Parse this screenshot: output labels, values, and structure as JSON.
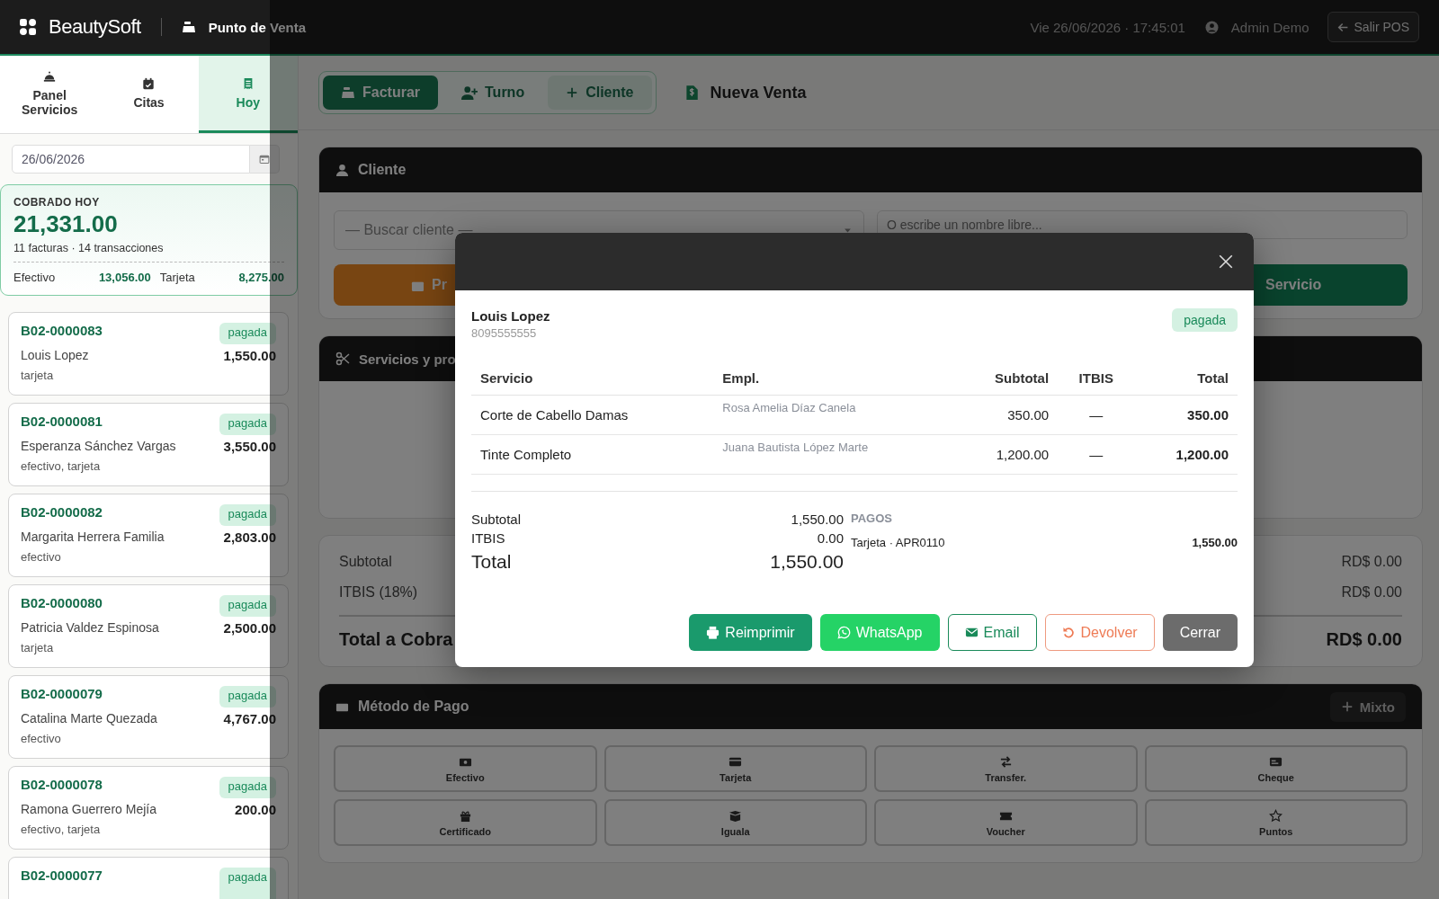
{
  "topbar": {
    "brand": "BeautySoft",
    "module": "Punto de Venta",
    "datetime": "Vie 26/06/2026 · 17:45:01",
    "user": "Admin Demo",
    "exit_button": "Salir POS"
  },
  "sidebar": {
    "tabs": [
      {
        "label": "Panel Servicios",
        "selected": false
      },
      {
        "label": "Citas",
        "selected": false
      },
      {
        "label": "Hoy",
        "selected": true
      }
    ],
    "date_field": {
      "value": "26/06/2026"
    },
    "summary": {
      "title": "COBRADO HOY",
      "amount": "21,331.00",
      "detail": "11 facturas · 14 transacciones",
      "breakdown": [
        {
          "label": "Efectivo",
          "amount": "13,056.00"
        },
        {
          "label": "Tarjeta",
          "amount": "8,275.00"
        }
      ]
    },
    "invoices": [
      {
        "number": "B02-0000083",
        "status": "pagada",
        "client": "Louis Lopez",
        "amount": "1,550.00",
        "methods": "tarjeta"
      },
      {
        "number": "B02-0000081",
        "status": "pagada",
        "client": "Esperanza Sánchez Vargas",
        "amount": "3,550.00",
        "methods": "efectivo, tarjeta"
      },
      {
        "number": "B02-0000082",
        "status": "pagada",
        "client": "Margarita Herrera Familia",
        "amount": "2,803.00",
        "methods": "efectivo"
      },
      {
        "number": "B02-0000080",
        "status": "pagada",
        "client": "Patricia Valdez Espinosa",
        "amount": "2,500.00",
        "methods": "tarjeta"
      },
      {
        "number": "B02-0000079",
        "status": "pagada",
        "client": "Catalina Marte Quezada",
        "amount": "4,767.00",
        "methods": "efectivo"
      },
      {
        "number": "B02-0000078",
        "status": "pagada",
        "client": "Ramona Guerrero Mejía",
        "amount": "200.00",
        "methods": "efectivo, tarjeta"
      },
      {
        "number": "B02-0000077",
        "status": "pagada"
      }
    ]
  },
  "main": {
    "mode_tabs": [
      {
        "label": "Facturar",
        "selected": true,
        "highlighted": false
      },
      {
        "label": "Turno",
        "selected": false,
        "highlighted": false
      },
      {
        "label": "Cliente",
        "selected": false,
        "highlighted": true
      }
    ],
    "title": "Nueva Venta",
    "client_card": {
      "title": "Cliente",
      "search_placeholder": "— Buscar cliente —",
      "name_placeholder": "O escribe un nombre libre...",
      "buttons": [
        {
          "label": "Pr",
          "kind": "orange"
        },
        {
          "label": "Servicio",
          "kind": "green"
        }
      ]
    },
    "services_card": {
      "title": "Servicios y pro"
    },
    "totals": {
      "rows": [
        {
          "label": "Subtotal",
          "value": "RD$ 0.00"
        },
        {
          "label": "ITBIS (18%)",
          "value": "RD$ 0.00"
        }
      ],
      "total": {
        "label": "Total a Cobra",
        "value": "RD$ 0.00"
      }
    },
    "payment": {
      "title": "Método de Pago",
      "mixed_button": "Mixto",
      "methods": [
        "Efectivo",
        "Tarjeta",
        "Transfer.",
        "Cheque",
        "Certificado",
        "Iguala",
        "Voucher",
        "Puntos"
      ]
    }
  },
  "modal": {
    "client": "Louis Lopez",
    "phone": "8095555555",
    "status": "pagada",
    "columns": [
      "Servicio",
      "Empl.",
      "Subtotal",
      "ITBIS",
      "Total"
    ],
    "rows": [
      [
        "Corte de Cabello Damas",
        "Rosa Amelia Díaz Canela",
        "350.00",
        "—",
        "350.00"
      ],
      [
        "Tinte Completo",
        "Juana Bautista López Marte",
        "1,200.00",
        "—",
        "1,200.00"
      ]
    ],
    "summary": [
      {
        "label": "Subtotal",
        "value": "1,550.00"
      },
      {
        "label": "ITBIS",
        "value": "0.00"
      }
    ],
    "total": {
      "label": "Total",
      "value": "1,550.00"
    },
    "payments_title": "PAGOS",
    "payments": [
      {
        "label": "Tarjeta · APR0110",
        "amount": "1,550.00"
      }
    ],
    "buttons": [
      {
        "label": "Reimprimir",
        "kind": "print"
      },
      {
        "label": "WhatsApp",
        "kind": "whatsapp"
      },
      {
        "label": "Email",
        "kind": "email"
      },
      {
        "label": "Devolver",
        "kind": "refund"
      },
      {
        "label": "Cerrar",
        "kind": "close"
      }
    ]
  }
}
